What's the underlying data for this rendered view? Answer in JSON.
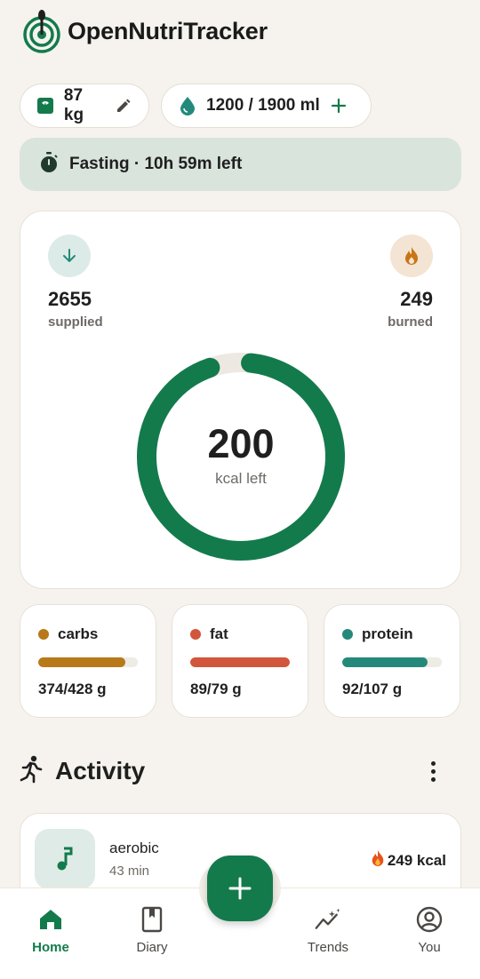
{
  "app": {
    "title": "OpenNutriTracker"
  },
  "chips": {
    "weight": "87 kg",
    "water": "1200 / 1900 ml"
  },
  "fasting": {
    "text": "Fasting · 10h 59m left"
  },
  "calories": {
    "supplied_value": "2655",
    "supplied_label": "supplied",
    "burned_value": "249",
    "burned_label": "burned",
    "left_value": "200",
    "left_label": "kcal left",
    "ring_progress": 0.93
  },
  "macros": [
    {
      "name": "carbs",
      "value": "374/428 g",
      "progress": 0.874,
      "color": "#b8791a"
    },
    {
      "name": "fat",
      "value": "89/79 g",
      "progress": 1.0,
      "color": "#d2563b"
    },
    {
      "name": "protein",
      "value": "92/107 g",
      "progress": 0.86,
      "color": "#24897b"
    }
  ],
  "activity": {
    "title": "Activity",
    "items": [
      {
        "name": "aerobic",
        "duration": "43 min",
        "kcal": "249 kcal"
      }
    ]
  },
  "nav": {
    "home": "Home",
    "diary": "Diary",
    "trends": "Trends",
    "you": "You"
  },
  "colors": {
    "primary": "#137a4c",
    "ring_track": "#ede9e2",
    "background": "#f6f3ee"
  },
  "icons": {
    "logo": "target-icon",
    "weight": "scale-icon",
    "edit": "pencil-icon",
    "water": "water-drop-icon",
    "add": "plus-icon",
    "fasting": "stopwatch-icon",
    "supplied": "arrow-down-icon",
    "burned": "flame-icon",
    "activity": "running-person-icon",
    "more": "more-vertical-icon",
    "music": "music-note-icon",
    "home": "home-icon",
    "diary": "book-icon",
    "trends": "trends-icon",
    "you": "account-icon"
  }
}
